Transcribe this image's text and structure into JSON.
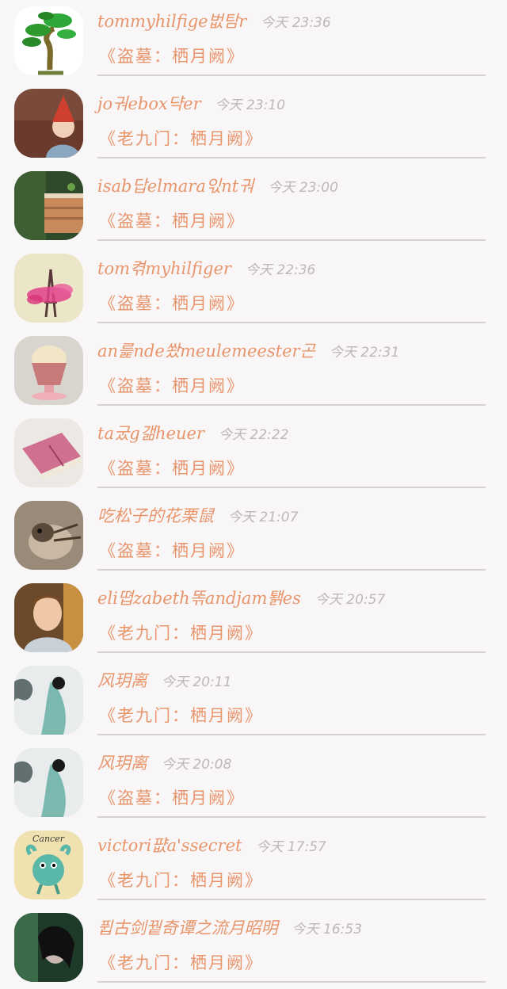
{
  "conversations": [
    {
      "name": "tommyhilfige벖탐r",
      "time": "今天 23:36",
      "preview": "《盗墓：栖月阙》",
      "avatar": "bonsai-tree-avatar"
    },
    {
      "name": "jo궈ebox댝er",
      "time": "今天 23:10",
      "preview": "《老九门：栖月阙》",
      "avatar": "child-red-hat-avatar"
    },
    {
      "name": "isab답elmara읷nt궈",
      "time": "今天 23:00",
      "preview": "《盗墓：栖月阙》",
      "avatar": "wooden-house-avatar"
    },
    {
      "name": "tom켞myhilfiger",
      "time": "今天 22:36",
      "preview": "《盗墓：栖月阙》",
      "avatar": "eiffel-tower-avatar"
    },
    {
      "name": "an릁nde쐈meulemeester곤",
      "time": "今天 22:31",
      "preview": "《盗墓：栖月阙》",
      "avatar": "cupcake-avatar"
    },
    {
      "name": "ta궀g갦heuer",
      "time": "今天 22:22",
      "preview": "《盗墓：栖月阙》",
      "avatar": "pink-book-avatar"
    },
    {
      "name": "吃松子的花栗鼠",
      "time": "今天 21:07",
      "preview": "《盗墓：栖月阙》",
      "avatar": "chipmunk-avatar"
    },
    {
      "name": "eli뗩zabeth똒andjam퇡es",
      "time": "今天 20:57",
      "preview": "《老九门：栖月阙》",
      "avatar": "boy-portrait-avatar"
    },
    {
      "name": "风玥离",
      "time": "今天 20:11",
      "preview": "《老九门：栖月阙》",
      "avatar": "ink-painting-lady-avatar"
    },
    {
      "name": "风玥离",
      "time": "今天 20:08",
      "preview": "《盗墓：栖月阙》",
      "avatar": "ink-painting-lady-avatar"
    },
    {
      "name": "victori퍖a'ssecret",
      "time": "今天 17:57",
      "preview": "《老九门：栖月阙》",
      "avatar": "cancer-zodiac-avatar",
      "avatar_text": "Cancer"
    },
    {
      "name": "퓝古剑꿭奇谭之流月昭明",
      "time": "今天 16:53",
      "preview": "《老九门：栖月阙》",
      "avatar": "dark-portrait-avatar"
    }
  ],
  "colors": {
    "accent": "#e8956c",
    "time": "#bdb7b7",
    "divider": "#d6d0cf",
    "background": "#f8f6f6"
  }
}
